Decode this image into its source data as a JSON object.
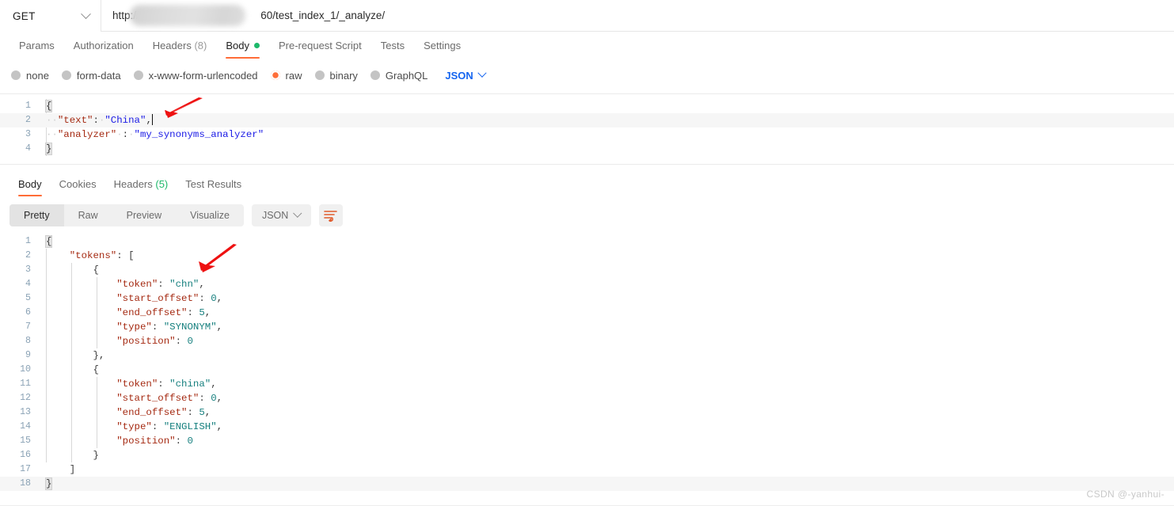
{
  "urlbar": {
    "method": "GET",
    "method_chevron_icon": "chevron-down-icon",
    "url_prefix": "http://1",
    "url_suffix": "60/test_index_1/_analyze/",
    "url_redacted": true
  },
  "request_tabs": [
    {
      "label": "Params",
      "active": false
    },
    {
      "label": "Authorization",
      "active": false
    },
    {
      "label": "Headers",
      "count": "(8)",
      "active": false
    },
    {
      "label": "Body",
      "active": true,
      "dot": "green"
    },
    {
      "label": "Pre-request Script",
      "active": false
    },
    {
      "label": "Tests",
      "active": false
    },
    {
      "label": "Settings",
      "active": false
    }
  ],
  "body_modes": [
    {
      "label": "none",
      "selected": false
    },
    {
      "label": "form-data",
      "selected": false
    },
    {
      "label": "x-www-form-urlencoded",
      "selected": false
    },
    {
      "label": "raw",
      "selected": true
    },
    {
      "label": "binary",
      "selected": false
    },
    {
      "label": "GraphQL",
      "selected": false
    }
  ],
  "body_format": {
    "label": "JSON",
    "chevron_icon": "chevron-down-icon"
  },
  "request_body": {
    "lines": [
      {
        "n": "1",
        "tokens": [
          {
            "t": "{",
            "c": "p-req",
            "hl": true
          }
        ]
      },
      {
        "n": "2",
        "highlight": true,
        "tokens": [
          {
            "t": "··",
            "c": "ws"
          },
          {
            "t": "\"text\"",
            "c": "k-req"
          },
          {
            "t": ":",
            "c": "p-req"
          },
          {
            "t": "·",
            "c": "ws"
          },
          {
            "t": "\"China\"",
            "c": "v-req"
          },
          {
            "t": ",",
            "c": "p-req"
          },
          {
            "t": "CARET",
            "c": "caret"
          }
        ]
      },
      {
        "n": "3",
        "tokens": [
          {
            "t": "··",
            "c": "ws"
          },
          {
            "t": "\"analyzer\"",
            "c": "k-req"
          },
          {
            "t": "·",
            "c": "ws"
          },
          {
            "t": ":",
            "c": "p-req"
          },
          {
            "t": "·",
            "c": "ws"
          },
          {
            "t": "\"my_synonyms_analyzer\"",
            "c": "v-req"
          }
        ]
      },
      {
        "n": "4",
        "tokens": [
          {
            "t": "}",
            "c": "p-req",
            "hl": true
          }
        ]
      }
    ]
  },
  "response_tabs": [
    {
      "label": "Body",
      "active": true
    },
    {
      "label": "Cookies",
      "active": false
    },
    {
      "label": "Headers",
      "count": "(5)",
      "active": false
    },
    {
      "label": "Test Results",
      "active": false
    }
  ],
  "response_format_tabs": [
    {
      "label": "Pretty",
      "selected": true
    },
    {
      "label": "Raw",
      "selected": false
    },
    {
      "label": "Preview",
      "selected": false
    },
    {
      "label": "Visualize",
      "selected": false
    }
  ],
  "response_format": {
    "label": "JSON",
    "chevron_icon": "chevron-down-icon",
    "wrap_icon": "text-wrap-icon"
  },
  "response_body": {
    "lines": [
      {
        "n": "1",
        "tokens": [
          {
            "t": "{",
            "c": "p-res",
            "hl": true
          }
        ]
      },
      {
        "n": "2",
        "tokens": [
          {
            "t": "    ",
            "c": "p-res"
          },
          {
            "t": "\"tokens\"",
            "c": "k-res"
          },
          {
            "t": ": [",
            "c": "p-res"
          }
        ]
      },
      {
        "n": "3",
        "tokens": [
          {
            "t": "        {",
            "c": "p-res"
          }
        ]
      },
      {
        "n": "4",
        "tokens": [
          {
            "t": "            ",
            "c": "p-res"
          },
          {
            "t": "\"token\"",
            "c": "k-res"
          },
          {
            "t": ": ",
            "c": "p-res"
          },
          {
            "t": "\"chn\"",
            "c": "s-res"
          },
          {
            "t": ",",
            "c": "p-res"
          }
        ]
      },
      {
        "n": "5",
        "tokens": [
          {
            "t": "            ",
            "c": "p-res"
          },
          {
            "t": "\"start_offset\"",
            "c": "k-res"
          },
          {
            "t": ": ",
            "c": "p-res"
          },
          {
            "t": "0",
            "c": "n-res"
          },
          {
            "t": ",",
            "c": "p-res"
          }
        ]
      },
      {
        "n": "6",
        "tokens": [
          {
            "t": "            ",
            "c": "p-res"
          },
          {
            "t": "\"end_offset\"",
            "c": "k-res"
          },
          {
            "t": ": ",
            "c": "p-res"
          },
          {
            "t": "5",
            "c": "n-res"
          },
          {
            "t": ",",
            "c": "p-res"
          }
        ]
      },
      {
        "n": "7",
        "tokens": [
          {
            "t": "            ",
            "c": "p-res"
          },
          {
            "t": "\"type\"",
            "c": "k-res"
          },
          {
            "t": ": ",
            "c": "p-res"
          },
          {
            "t": "\"SYNONYM\"",
            "c": "s-res"
          },
          {
            "t": ",",
            "c": "p-res"
          }
        ]
      },
      {
        "n": "8",
        "tokens": [
          {
            "t": "            ",
            "c": "p-res"
          },
          {
            "t": "\"position\"",
            "c": "k-res"
          },
          {
            "t": ": ",
            "c": "p-res"
          },
          {
            "t": "0",
            "c": "n-res"
          }
        ]
      },
      {
        "n": "9",
        "tokens": [
          {
            "t": "        },",
            "c": "p-res"
          }
        ]
      },
      {
        "n": "10",
        "tokens": [
          {
            "t": "        {",
            "c": "p-res"
          }
        ]
      },
      {
        "n": "11",
        "tokens": [
          {
            "t": "            ",
            "c": "p-res"
          },
          {
            "t": "\"token\"",
            "c": "k-res"
          },
          {
            "t": ": ",
            "c": "p-res"
          },
          {
            "t": "\"china\"",
            "c": "s-res"
          },
          {
            "t": ",",
            "c": "p-res"
          }
        ]
      },
      {
        "n": "12",
        "tokens": [
          {
            "t": "            ",
            "c": "p-res"
          },
          {
            "t": "\"start_offset\"",
            "c": "k-res"
          },
          {
            "t": ": ",
            "c": "p-res"
          },
          {
            "t": "0",
            "c": "n-res"
          },
          {
            "t": ",",
            "c": "p-res"
          }
        ]
      },
      {
        "n": "13",
        "tokens": [
          {
            "t": "            ",
            "c": "p-res"
          },
          {
            "t": "\"end_offset\"",
            "c": "k-res"
          },
          {
            "t": ": ",
            "c": "p-res"
          },
          {
            "t": "5",
            "c": "n-res"
          },
          {
            "t": ",",
            "c": "p-res"
          }
        ]
      },
      {
        "n": "14",
        "tokens": [
          {
            "t": "            ",
            "c": "p-res"
          },
          {
            "t": "\"type\"",
            "c": "k-res"
          },
          {
            "t": ": ",
            "c": "p-res"
          },
          {
            "t": "\"ENGLISH\"",
            "c": "s-res"
          },
          {
            "t": ",",
            "c": "p-res"
          }
        ]
      },
      {
        "n": "15",
        "tokens": [
          {
            "t": "            ",
            "c": "p-res"
          },
          {
            "t": "\"position\"",
            "c": "k-res"
          },
          {
            "t": ": ",
            "c": "p-res"
          },
          {
            "t": "0",
            "c": "n-res"
          }
        ]
      },
      {
        "n": "16",
        "tokens": [
          {
            "t": "        }",
            "c": "p-res"
          }
        ]
      },
      {
        "n": "17",
        "tokens": [
          {
            "t": "    ]",
            "c": "p-res"
          }
        ]
      },
      {
        "n": "18",
        "highlight": true,
        "tokens": [
          {
            "t": "}",
            "c": "p-res",
            "hl": true
          }
        ]
      }
    ]
  },
  "annotations": [
    {
      "name": "arrow-request-body",
      "color": "#ee1111"
    },
    {
      "name": "arrow-response-token",
      "color": "#ee1111"
    }
  ],
  "watermark": {
    "text": "CSDN @-yanhui-"
  },
  "colors": {
    "accent_orange": "#ff6c37",
    "green": "#1eb96b",
    "link_blue": "#1565f0",
    "arrow_red": "#ee1111"
  }
}
